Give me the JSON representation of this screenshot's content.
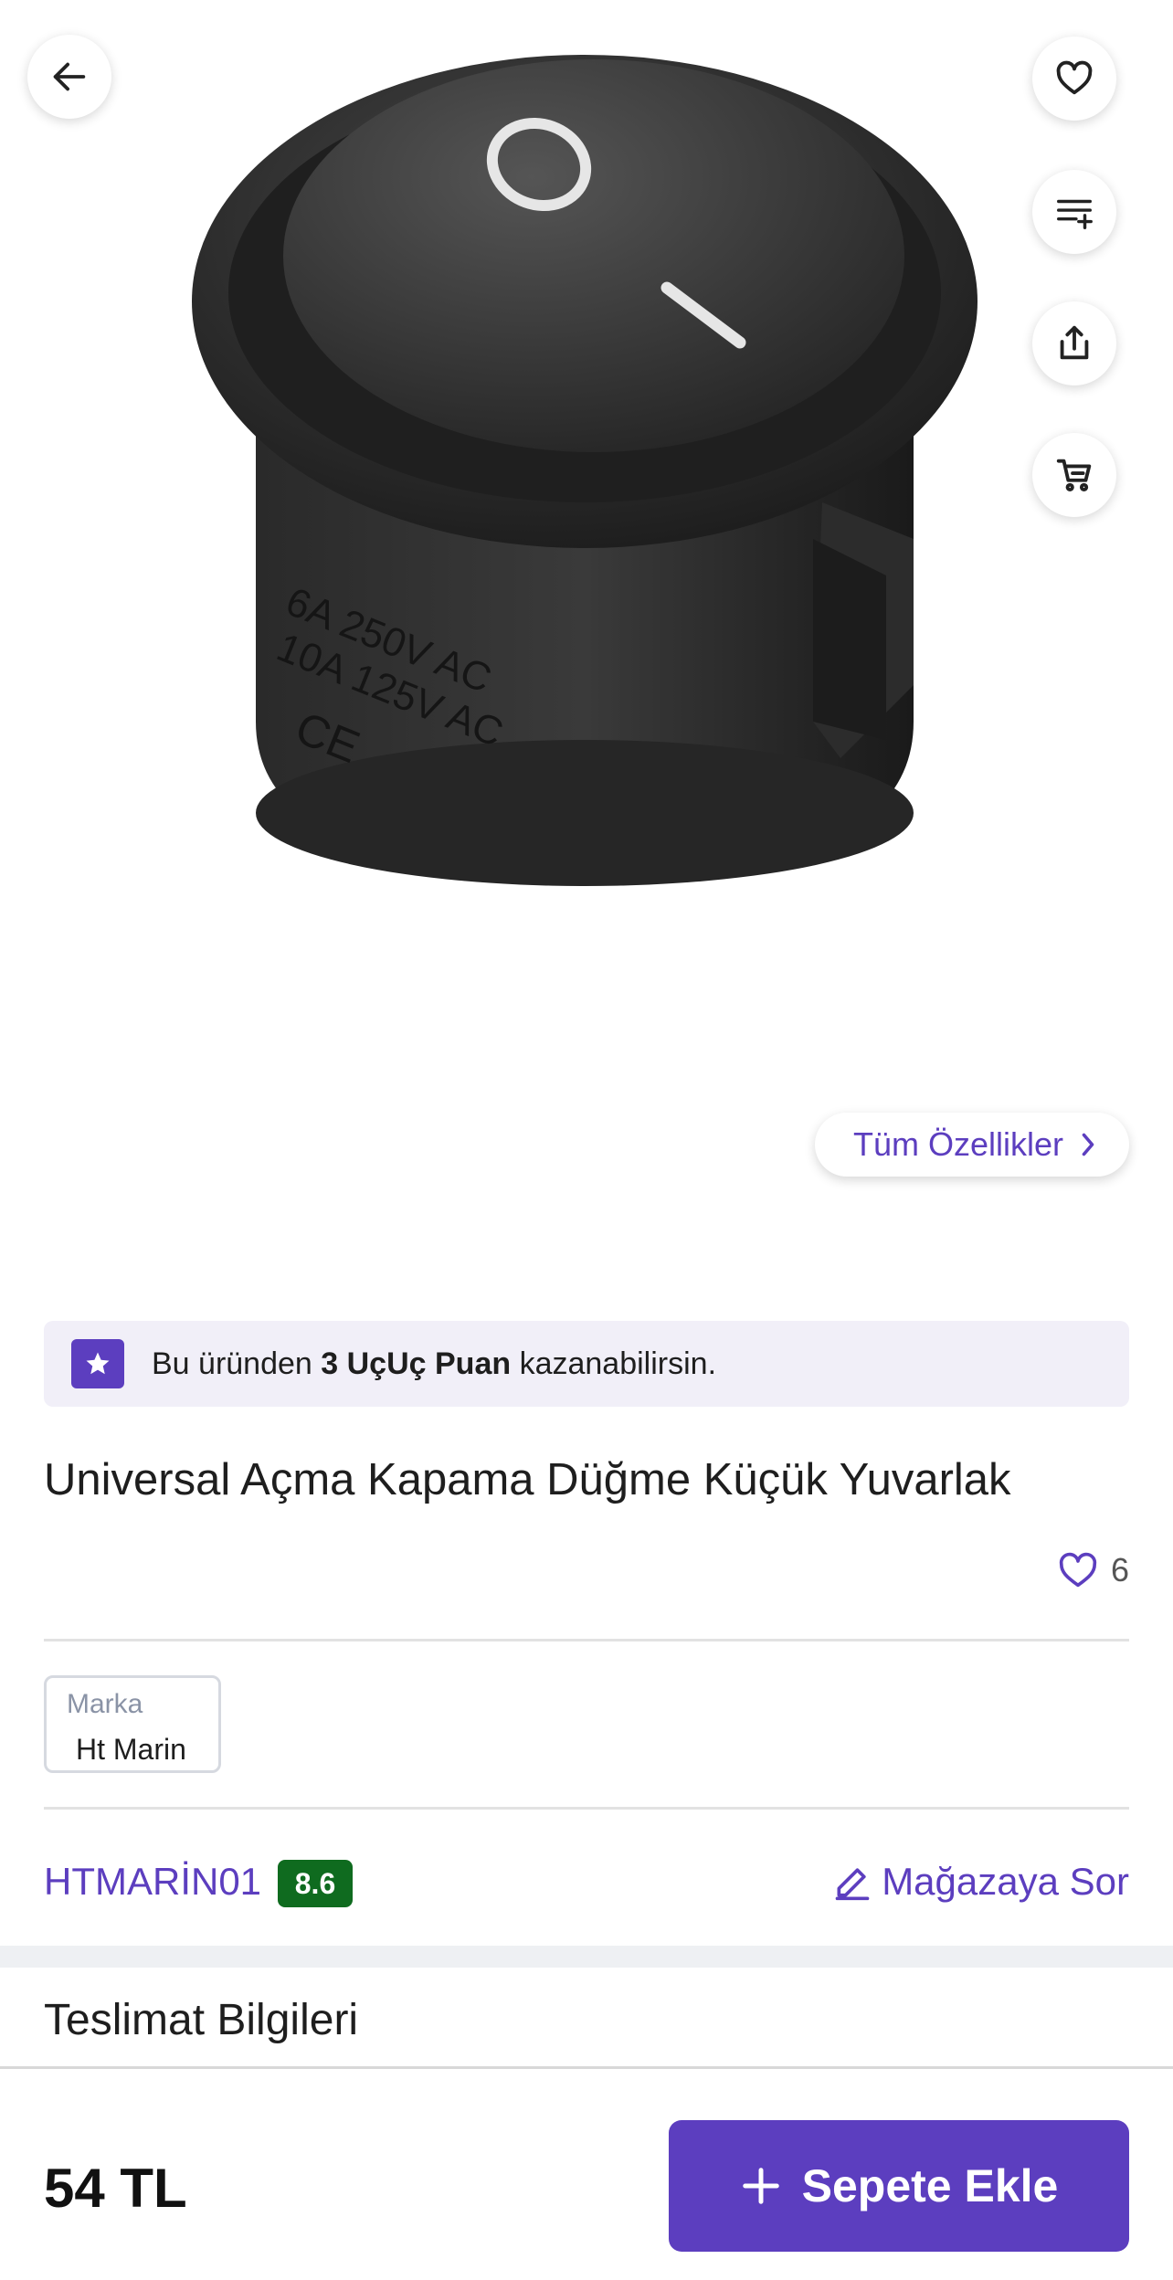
{
  "all_features_label": "Tüm Özellikler",
  "points_banner": {
    "prefix": "Bu üründen ",
    "highlight": "3 UçUç Puan",
    "suffix": " kazanabilirsin."
  },
  "product": {
    "title": "Universal Açma Kapama Düğme Küçük Yuvarlak",
    "favorite_count": "6",
    "image_text": {
      "off_mark": "O",
      "on_mark": "I",
      "rating_1": "6A 250V AC",
      "rating_2": "10A 125V AC",
      "ce": "CE"
    }
  },
  "brand": {
    "label": "Marka",
    "value": "Ht Marin"
  },
  "seller": {
    "name": "HTMARİN01",
    "rating": "8.6",
    "ask_label": "Mağazaya Sor"
  },
  "delivery": {
    "title": "Teslimat Bilgileri"
  },
  "bottom_bar": {
    "price": "54 TL",
    "add_to_cart_label": "Sepete Ekle"
  },
  "icons": {
    "back": "arrow-left-icon",
    "favorite": "heart-icon",
    "add_to_list": "list-plus-icon",
    "share": "share-icon",
    "cart": "cart-icon"
  },
  "colors": {
    "accent": "#5c3ebf",
    "rating_badge": "#0f6b1f",
    "banner_bg": "#f1eff8"
  }
}
